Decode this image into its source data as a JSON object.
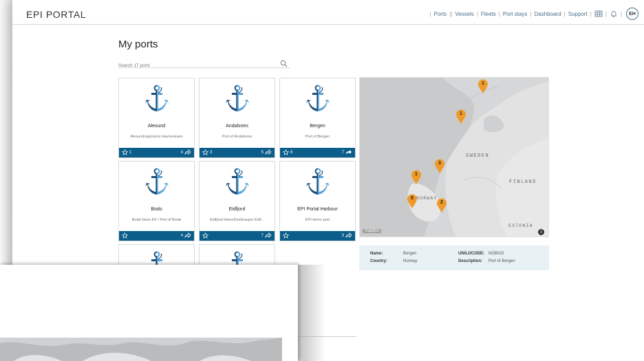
{
  "app": {
    "logo": "EPI PORTAL"
  },
  "nav": {
    "items": [
      {
        "label": "Ports",
        "active": true
      },
      {
        "label": "Vessels"
      },
      {
        "label": "Fleets"
      },
      {
        "label": "Port stays"
      },
      {
        "label": "Dashboard"
      },
      {
        "label": "Support"
      }
    ],
    "icons": [
      "grid-icon",
      "bell-icon"
    ],
    "avatar": "EH"
  },
  "page": {
    "title": "My ports",
    "search_placeholder": "Search 17 ports"
  },
  "ports": [
    {
      "name": "Alesund",
      "sub": "Ålesundregionens Havnevesen",
      "left_count": "1",
      "right_count": "4"
    },
    {
      "name": "Andalsnes",
      "sub": "Port of Åndalsnes",
      "left_count": "3",
      "right_count": "5"
    },
    {
      "name": "Bergen",
      "sub": "Port of Bergen",
      "left_count": "8",
      "right_count": "7"
    },
    {
      "name": "Bodo",
      "sub": "Bodø Havn KF / Port of Bodø",
      "left_count": "",
      "right_count": "4"
    },
    {
      "name": "Eidfjord",
      "sub": "Eidfjord Havn/Destinasjon Eidf...",
      "left_count": "",
      "right_count": "7"
    },
    {
      "name": "EPI Portal Harbour",
      "sub": "EPI demo port",
      "left_count": "",
      "right_count": "3"
    }
  ],
  "map": {
    "labels": [
      "SWEDEN",
      "FINLAND",
      "NORWAY",
      "ESTONIA"
    ],
    "clusters": [
      "1",
      "1",
      "3",
      "1",
      "9",
      "2"
    ],
    "attribution": "mapbox"
  },
  "info": {
    "name_label": "Name:",
    "name_value": "Bergen",
    "country_label": "Country:",
    "country_value": "Norway",
    "unlocode_label": "UN/LOCODE:",
    "unlocode_value": "NOBGO",
    "description_label": "Description:",
    "description_value": "Port of Bergen"
  },
  "colors": {
    "accent": "#0b5e8a",
    "marker": "#ef9a2a",
    "anchor_dark": "#1f4f7c",
    "anchor_light": "#5aa3d6"
  }
}
